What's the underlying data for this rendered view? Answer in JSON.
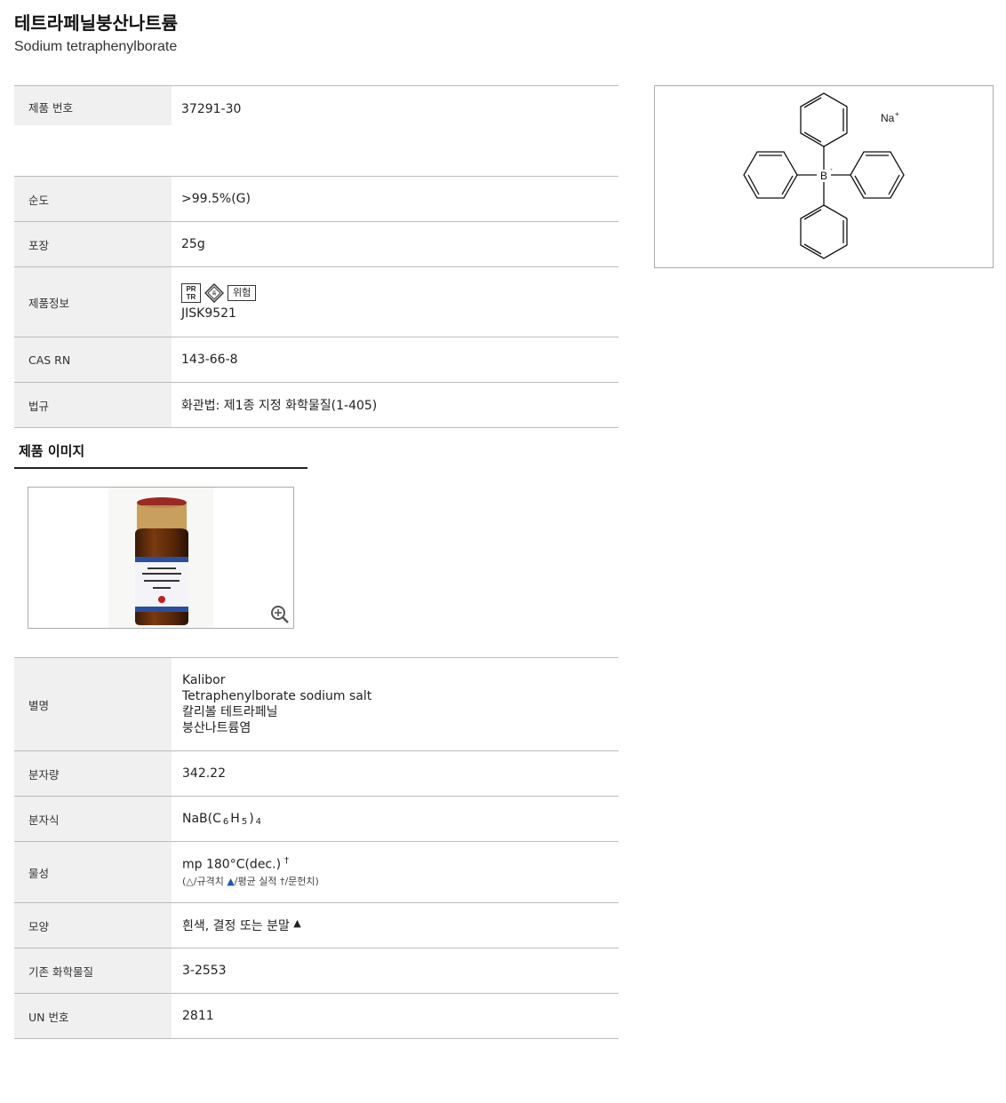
{
  "header": {
    "title": "테트라페닐붕산나트륨",
    "subtitle": "Sodium tetraphenylborate"
  },
  "specs": {
    "product_no_label": "제품 번호",
    "product_no": "37291-30",
    "purity_label": "순도",
    "purity": ">99.5%(G)",
    "package_label": "포장",
    "package": "25g",
    "info_label": "제품정보",
    "info_icons": [
      "PR TR",
      "diamond-hazard-icon",
      "위험"
    ],
    "info_text": "JISK9521",
    "cas_label": "CAS RN",
    "cas": "143-66-8",
    "law_label": "법규",
    "law": "화관법: 제1종 지정 화학물질(1-405)"
  },
  "image_section": {
    "heading": "제품 이미지"
  },
  "structure": {
    "cation": "Na",
    "cation_charge": "+",
    "center": "B",
    "center_charge": "-"
  },
  "details": {
    "alias_label": "별명",
    "aliases": [
      "Kalibor",
      "Tetraphenylborate sodium salt",
      "칼리볼 테트라페닐",
      "붕산나트륨염"
    ],
    "mw_label": "분자량",
    "mw": "342.22",
    "formula_label": "분자식",
    "formula_prefix": "NaB(C",
    "formula_sub1": "6",
    "formula_mid": "H",
    "formula_sub2": "5",
    "formula_close": ")",
    "formula_sub3": "4",
    "props_label": "물성",
    "props": "mp 180°C(dec.)",
    "props_mark": "†",
    "props_note_1": "(△/규격치 ",
    "props_note_tri": "▲",
    "props_note_2": "/평균 실적 †/문헌치)",
    "shape_label": "모양",
    "shape": "흰색, 결정 또는 분말",
    "shape_mark": "▲",
    "existing_label": "기존 화학물질",
    "existing": "3-2553",
    "un_label": "UN 번호",
    "un": "2811"
  },
  "colors": {
    "label_bg": "#f0f0f0",
    "border": "#bcbcbc",
    "accent_blue": "#1f5aa8"
  }
}
